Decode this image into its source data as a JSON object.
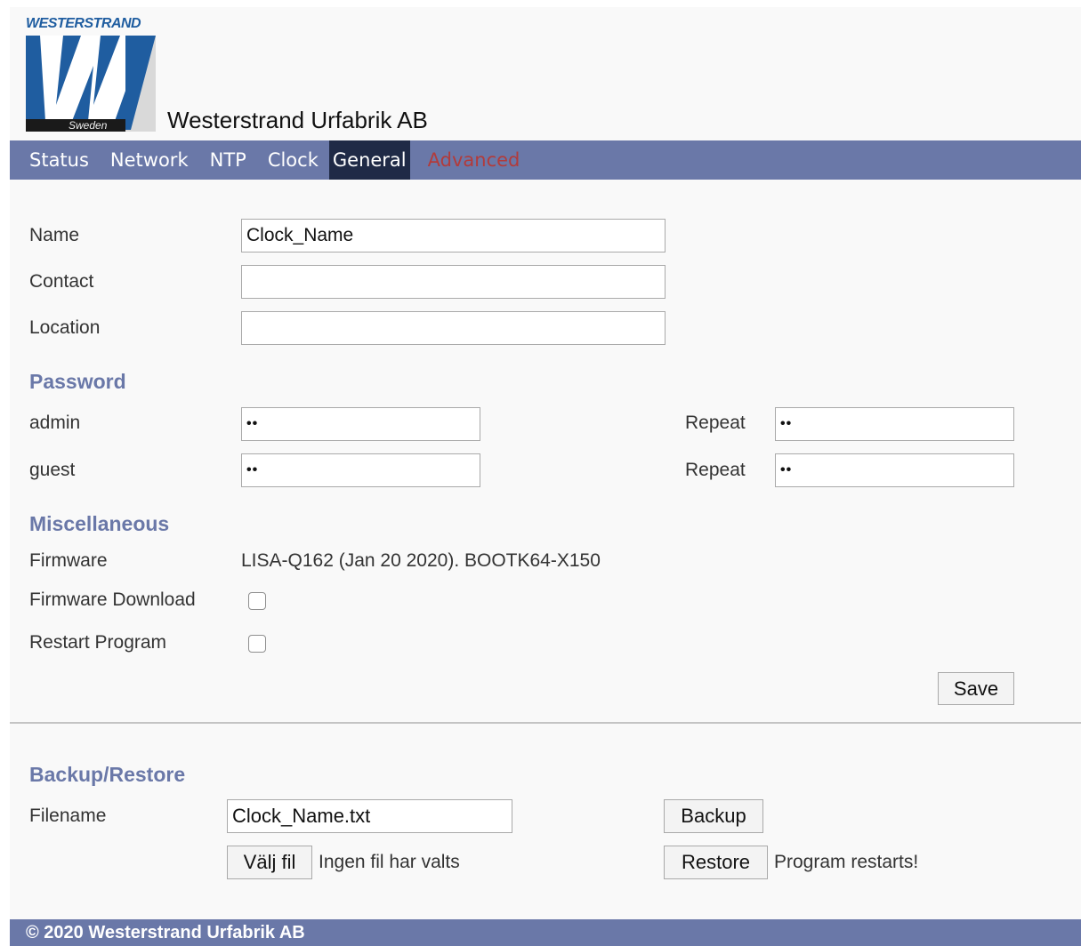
{
  "header": {
    "logo_brand": "WESTERSTRAND",
    "logo_country": "Sweden",
    "title": "Westerstrand Urfabrik AB"
  },
  "nav": {
    "items": [
      {
        "label": "Status"
      },
      {
        "label": "Network"
      },
      {
        "label": "NTP"
      },
      {
        "label": "Clock"
      },
      {
        "label": "General",
        "active": true
      },
      {
        "label": "Advanced"
      }
    ]
  },
  "general": {
    "name_label": "Name",
    "name_value": "Clock_Name",
    "contact_label": "Contact",
    "contact_value": "",
    "location_label": "Location",
    "location_value": ""
  },
  "password": {
    "heading": "Password",
    "admin_label": "admin",
    "admin_value": "••",
    "admin_repeat_label": "Repeat",
    "admin_repeat_value": "••",
    "guest_label": "guest",
    "guest_value": "••",
    "guest_repeat_label": "Repeat",
    "guest_repeat_value": "••"
  },
  "misc": {
    "heading": "Miscellaneous",
    "firmware_label": "Firmware",
    "firmware_value": "LISA-Q162 (Jan 20 2020). BOOTK64-X150",
    "firmware_download_label": "Firmware Download",
    "firmware_download_checked": false,
    "restart_label": "Restart Program",
    "restart_checked": false,
    "save_label": "Save"
  },
  "backup": {
    "heading": "Backup/Restore",
    "filename_label": "Filename",
    "filename_value": "Clock_Name.txt",
    "backup_label": "Backup",
    "choose_file_label": "Välj fil",
    "no_file_text": "Ingen fil har valts",
    "restore_label": "Restore",
    "restart_note": "Program restarts!"
  },
  "footer": {
    "text": "© 2020 Westerstrand Urfabrik AB"
  },
  "colors": {
    "nav_bg": "#6a78a8",
    "nav_active_bg": "#1f2a46",
    "advanced_text": "#b23b3b",
    "section_heading": "#6a78a8",
    "logo_blue": "#1f5da0"
  }
}
